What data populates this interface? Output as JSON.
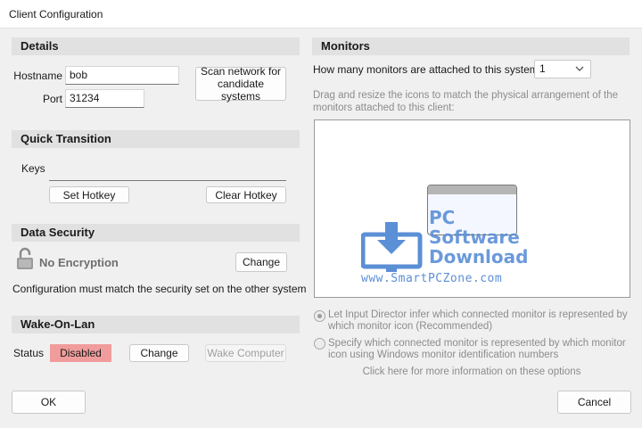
{
  "window": {
    "title": "Client Configuration"
  },
  "details": {
    "header": "Details",
    "hostname_label": "Hostname",
    "hostname_value": "bob",
    "port_label": "Port",
    "port_value": "31234",
    "scan_button": "Scan network for candidate systems"
  },
  "quick_transition": {
    "header": "Quick Transition",
    "keys_label": "Keys",
    "keys_value": "",
    "set_hotkey": "Set Hotkey",
    "clear_hotkey": "Clear Hotkey"
  },
  "data_security": {
    "header": "Data Security",
    "encryption_status": "No Encryption",
    "change_button": "Change",
    "note": "Configuration must match the security set on the other system"
  },
  "wake_on_lan": {
    "header": "Wake-On-Lan",
    "status_label": "Status",
    "status_value": "Disabled",
    "status_color": "#f19c9c",
    "change_button": "Change",
    "wake_button": "Wake Computer"
  },
  "monitors": {
    "header": "Monitors",
    "count_label": "How many monitors are attached to this system",
    "count_value": "1",
    "instructions": "Drag and resize the icons to match the physical arrangement of the monitors attached to this client:",
    "option_infer": "Let Input Director infer which connected monitor is represented by which monitor icon (Recommended)",
    "option_specify": "Specify which connected monitor is represented by which monitor icon using Windows monitor identification numbers",
    "info_link": "Click here for more information on these options"
  },
  "watermark": {
    "line1": "PC",
    "line2": "Software",
    "line3": "Download",
    "url": "www.SmartPCZone.com",
    "color": "#5b8fd6"
  },
  "footer": {
    "ok": "OK",
    "cancel": "Cancel"
  }
}
